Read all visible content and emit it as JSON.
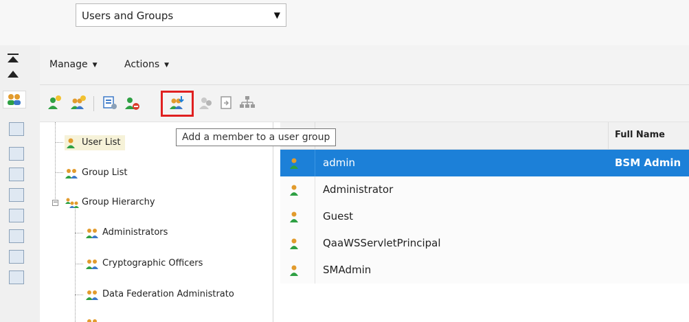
{
  "view_selector": {
    "value": "Users and Groups",
    "icon": "dropdown-arrow"
  },
  "menubar": {
    "manage_label": "Manage",
    "actions_label": "Actions"
  },
  "toolbar": {
    "icons": [
      "new-user-icon",
      "new-group-icon",
      "properties-icon",
      "remove-user-icon",
      "add-member-icon",
      "copy-user-icon",
      "export-icon",
      "hierarchy-icon"
    ],
    "highlighted": "add-member-icon"
  },
  "tooltip": {
    "text": "Add a member to a user group"
  },
  "tree": {
    "items": [
      {
        "label": "User List",
        "icon": "user-icon",
        "selected": true
      },
      {
        "label": "Group List",
        "icon": "group-icon",
        "selected": false
      },
      {
        "label": "Group Hierarchy",
        "icon": "group-hierarchy-icon",
        "selected": false,
        "expander": "⊟"
      },
      {
        "label": "Administrators",
        "icon": "group-icon",
        "selected": false
      },
      {
        "label": "Cryptographic Officers",
        "icon": "group-icon",
        "selected": false
      },
      {
        "label": "Data Federation Administrato",
        "icon": "group-icon",
        "selected": false
      }
    ]
  },
  "table": {
    "columns": [
      "Full Name"
    ],
    "rows": [
      {
        "name": "admin",
        "full_name": "BSM Admin",
        "selected": true
      },
      {
        "name": "Administrator",
        "full_name": "",
        "selected": false
      },
      {
        "name": "Guest",
        "full_name": "",
        "selected": false
      },
      {
        "name": "QaaWSServletPrincipal",
        "full_name": "",
        "selected": false
      },
      {
        "name": "SMAdmin",
        "full_name": "",
        "selected": false
      }
    ]
  },
  "colors": {
    "selection_blue": "#1c80d8",
    "highlight_red": "#e02020",
    "tree_selection": "#f6f2d8",
    "user_icon_green": "#2ea043",
    "group_icon_orange": "#e29b2d"
  }
}
